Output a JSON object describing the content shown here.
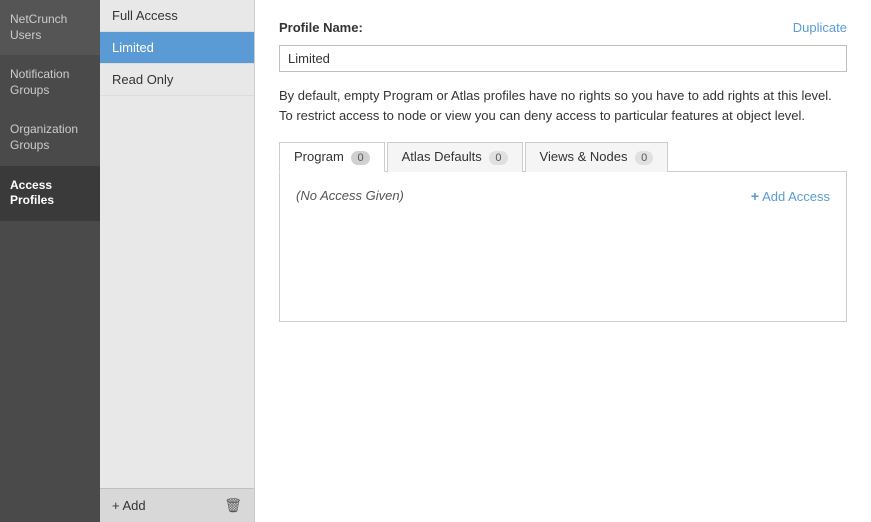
{
  "sidebar": {
    "items": [
      {
        "id": "netcrunch-users",
        "label": "NetCrunch Users"
      },
      {
        "id": "notification-groups",
        "label": "Notification Groups"
      },
      {
        "id": "organization-groups",
        "label": "Organization Groups"
      },
      {
        "id": "access-profiles",
        "label": "Access Profiles",
        "active": true
      }
    ]
  },
  "profile_list": {
    "items": [
      {
        "id": "full-access",
        "label": "Full Access"
      },
      {
        "id": "limited",
        "label": "Limited",
        "selected": true
      },
      {
        "id": "read-only",
        "label": "Read Only"
      }
    ],
    "footer": {
      "add_label": "+ Add",
      "delete_icon": "🗑"
    }
  },
  "main": {
    "profile_name_label": "Profile Name:",
    "duplicate_label": "Duplicate",
    "profile_name_value": "Limited",
    "description": "By default, empty Program or Atlas profiles have no rights so you have to add rights at this level. To restrict access to node or view you can deny access to particular features at object level.",
    "tabs": [
      {
        "id": "program",
        "label": "Program",
        "count": "0",
        "active": true
      },
      {
        "id": "atlas-defaults",
        "label": "Atlas Defaults",
        "count": "0"
      },
      {
        "id": "views-nodes",
        "label": "Views & Nodes",
        "count": "0"
      }
    ],
    "tab_content": {
      "no_access_text": "(No Access Given)",
      "add_access_label": "+ Add Access"
    }
  }
}
